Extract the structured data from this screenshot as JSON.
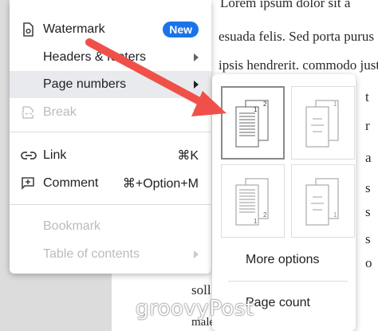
{
  "document": {
    "lines": [
      "Lorem ipsum dolor sit a",
      "esuada felis. Sed porta purus",
      "ipsis hendrerit. commodo justo",
      "t",
      "r",
      "a",
      "s",
      "s",
      "s",
      "o",
      "soll",
      "malesuada odio et justo"
    ]
  },
  "menu": {
    "items": [
      {
        "label": "Watermark",
        "badge": "New"
      },
      {
        "label": "Headers & footers"
      },
      {
        "label": "Page numbers"
      },
      {
        "label": "Break"
      },
      {
        "label": "Link",
        "shortcut": "⌘K"
      },
      {
        "label": "Comment",
        "shortcut": "⌘+Option+M"
      },
      {
        "label": "Bookmark"
      },
      {
        "label": "Table of contents"
      }
    ]
  },
  "submenu": {
    "page_glyphs": [
      "1",
      "2"
    ],
    "more_options": "More options",
    "page_count": "Page count"
  },
  "watermark": "groovyPost",
  "colors": {
    "accent": "#1a73e8",
    "arrow": "#f0504a"
  }
}
